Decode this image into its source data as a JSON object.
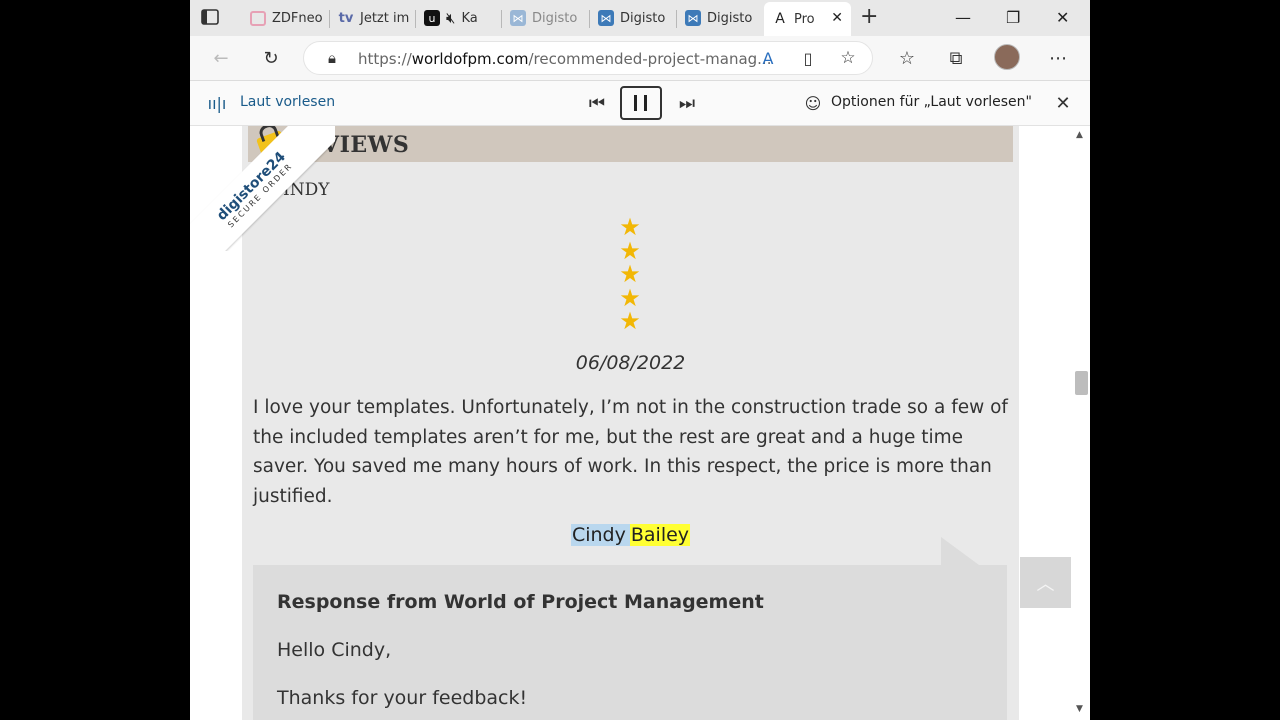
{
  "browser": {
    "tabs": [
      {
        "label": "ZDFneo",
        "fav_color": "#e7a1b5",
        "fav_glyph": "tv"
      },
      {
        "label": "Jetzt im",
        "fav_color": "#5a6aa8",
        "fav_glyph": "tv"
      },
      {
        "label": "Ka",
        "fav_color": "#111111",
        "fav_glyph": "u"
      },
      {
        "label": "Digisto",
        "fav_color": "#9ab7d6",
        "fav_glyph": "ds"
      },
      {
        "label": "Digisto",
        "fav_color": "#3d7ab8",
        "fav_glyph": "ds"
      },
      {
        "label": "Digisto",
        "fav_color": "#3d7ab8",
        "fav_glyph": "ds"
      },
      {
        "label": "Pro",
        "fav_color": "#ffffff",
        "fav_glyph": "A"
      }
    ],
    "url_prefix": "https://",
    "url_domain": "worldofpm.com",
    "url_path": "/recommended-project-manag..."
  },
  "read_aloud": {
    "title": "Laut vorlesen",
    "options_label": "Optionen für „Laut vorlesen\""
  },
  "page": {
    "section_title": "REVIEWS",
    "reviewer_top": "CINDY",
    "rating": 5,
    "date": "06/08/2022",
    "review_text": "I love your templates. Unfortunately, I’m not in the construction trade so a few of the included templates aren’t for me, but the rest are great and a huge time saver. You saved me many hours of work. In this respect, the price is more than justified.",
    "author_first": "Cindy",
    "author_last": "Bailey",
    "response": {
      "title": "Response from World of Project Management",
      "greeting": "Hello Cindy,",
      "line1": "Thanks for your feedback!"
    },
    "badge": {
      "brand": "digistore24",
      "sub": "SECURE ORDER"
    }
  }
}
